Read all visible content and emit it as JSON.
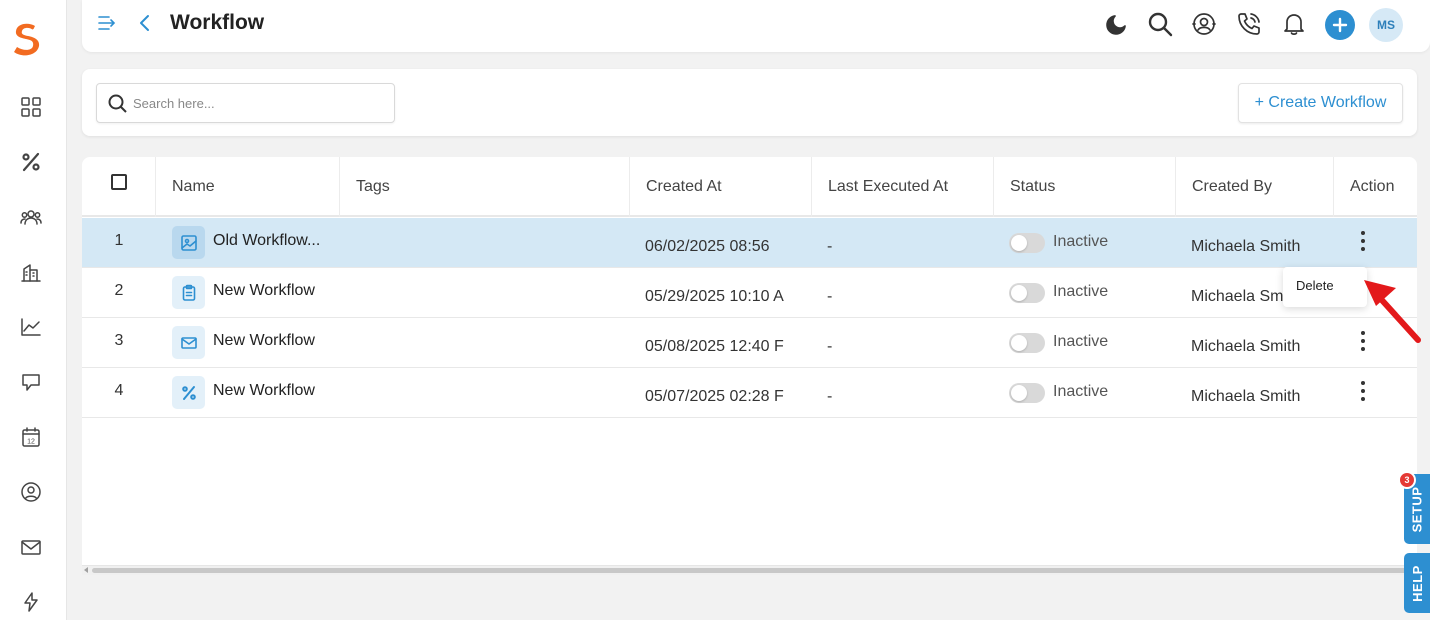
{
  "header": {
    "title": "Workflow",
    "avatar_initials": "MS",
    "icons": [
      "menu-toggle-icon",
      "back-icon",
      "moon-icon",
      "search-icon",
      "support-icon",
      "phone-icon",
      "bell-icon",
      "plus-icon"
    ]
  },
  "sidebar": {
    "items": [
      "dashboard-icon",
      "percent-icon",
      "users-icon",
      "buildings-icon",
      "chart-line-icon",
      "thumbs-down-icon",
      "calendar-icon",
      "user-circle-icon",
      "mail-icon",
      "bolt-icon"
    ],
    "calendar_day": "12"
  },
  "search": {
    "placeholder": "Search here...",
    "create_label": "+ Create Workflow"
  },
  "table": {
    "columns": [
      "Name",
      "Tags",
      "Created At",
      "Last Executed At",
      "Status",
      "Created By",
      "Action"
    ],
    "rows": [
      {
        "num": "1",
        "icon": "image-icon",
        "name": "Old Workflow...",
        "created_at": "06/02/2025 08:56",
        "last_executed": "-",
        "status": "Inactive",
        "created_by": "Michaela Smith"
      },
      {
        "num": "2",
        "icon": "clipboard-icon",
        "name": "New Workflow",
        "created_at": "05/29/2025 10:10 A",
        "last_executed": "-",
        "status": "Inactive",
        "created_by": "Michaela Sm"
      },
      {
        "num": "3",
        "icon": "mail-icon",
        "name": "New Workflow",
        "created_at": "05/08/2025 12:40 F",
        "last_executed": "-",
        "status": "Inactive",
        "created_by": "Michaela Smith"
      },
      {
        "num": "4",
        "icon": "percent-icon",
        "name": "New Workflow",
        "created_at": "05/07/2025 02:28 F",
        "last_executed": "-",
        "status": "Inactive",
        "created_by": "Michaela Smith"
      }
    ]
  },
  "dropdown": {
    "delete_label": "Delete"
  },
  "floating": {
    "setup_label": "SETUP",
    "setup_badge": "3",
    "help_label": "HELP"
  },
  "colors": {
    "accent": "#2d8fd1",
    "brand": "#f26b21",
    "selected_row": "#d4e8f5",
    "arrow": "#e3191b"
  }
}
